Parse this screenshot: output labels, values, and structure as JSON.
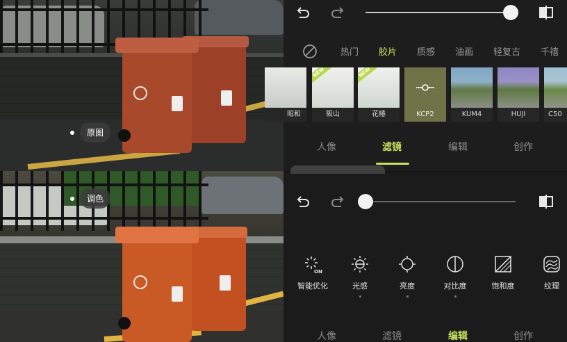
{
  "comparison": {
    "original_label": "原图",
    "adjusted_label": "调色"
  },
  "filter_panel": {
    "categories": [
      {
        "label": "热门",
        "active": false
      },
      {
        "label": "胶片",
        "active": true
      },
      {
        "label": "质感",
        "active": false
      },
      {
        "label": "油画",
        "active": false
      },
      {
        "label": "轻复古",
        "active": false
      },
      {
        "label": "千禧",
        "active": false
      }
    ],
    "filters": [
      {
        "label": "昭和",
        "new": false
      },
      {
        "label": "筱山",
        "new": true
      },
      {
        "label": "花椿",
        "new": true
      },
      {
        "label": "KCP2",
        "new": false,
        "selected": true
      },
      {
        "label": "KUM4",
        "new": false
      },
      {
        "label": "HUJI",
        "new": false
      },
      {
        "label": "C50",
        "new": false
      }
    ],
    "new_badge": "NEW",
    "intensity": 1.0
  },
  "main_tabs_top": [
    {
      "label": "人像",
      "active": false
    },
    {
      "label": "滤镜",
      "active": true
    },
    {
      "label": "编辑",
      "active": false
    },
    {
      "label": "创作",
      "active": false
    }
  ],
  "edit_panel": {
    "slider_value": 0.0,
    "tools": [
      {
        "label": "智能优化",
        "icon": "auto-enhance-icon",
        "marked": false
      },
      {
        "label": "光感",
        "icon": "light-icon",
        "marked": true
      },
      {
        "label": "亮度",
        "icon": "brightness-icon",
        "marked": true
      },
      {
        "label": "对比度",
        "icon": "contrast-icon",
        "marked": true
      },
      {
        "label": "饱和度",
        "icon": "saturation-icon",
        "marked": false
      },
      {
        "label": "纹理",
        "icon": "texture-icon",
        "marked": false
      }
    ],
    "auto_badge": "ON"
  },
  "main_tabs_bottom": [
    {
      "label": "人像",
      "active": false
    },
    {
      "label": "滤镜",
      "active": false
    },
    {
      "label": "编辑",
      "active": true
    },
    {
      "label": "创作",
      "active": false
    }
  ],
  "colors": {
    "accent": "#c6e25c",
    "bin_original": "#a8492c",
    "bin_adjusted": "#c95a26"
  }
}
